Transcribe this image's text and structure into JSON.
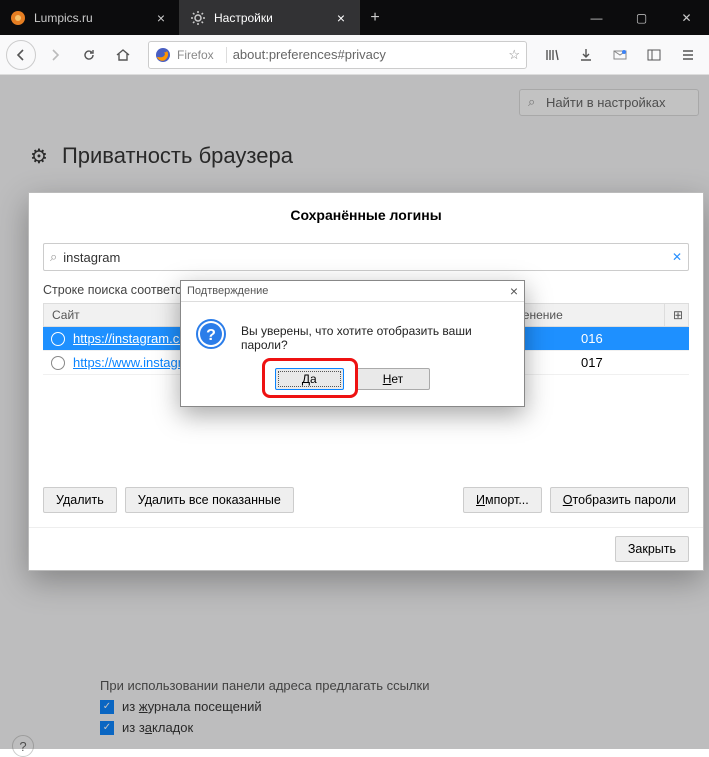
{
  "tabs": [
    {
      "label": "Lumpics.ru"
    },
    {
      "label": "Настройки"
    }
  ],
  "urlbar": {
    "brand": "Firefox",
    "url": "about:preferences#privacy"
  },
  "page": {
    "search_placeholder": "Найти в настройках",
    "heading": "Приватность браузера",
    "suggest_line": "При использовании панели адреса предлагать ссылки",
    "opt_history": "из журнала посещений",
    "opt_bookmarks": "из закладок"
  },
  "logins": {
    "title": "Сохранённые логины",
    "search_value": "instagram",
    "hint": "Строке поиска соответствуют следующие логины:",
    "col_site": "Сайт",
    "col_modified": "днее изменение",
    "rows": [
      {
        "url": "https://instagram.com",
        "mod": "016",
        "selected": true
      },
      {
        "url": "https://www.instagram",
        "mod": "017",
        "selected": false
      }
    ],
    "btn_delete": "Удалить",
    "btn_delete_all": "Удалить все показанные",
    "btn_import": "Импорт...",
    "btn_show": "Отобразить пароли",
    "btn_close": "Закрыть"
  },
  "confirm": {
    "title": "Подтверждение",
    "message": "Вы уверены, что хотите отобразить ваши пароли?",
    "yes": "Да",
    "no": "Нет"
  }
}
